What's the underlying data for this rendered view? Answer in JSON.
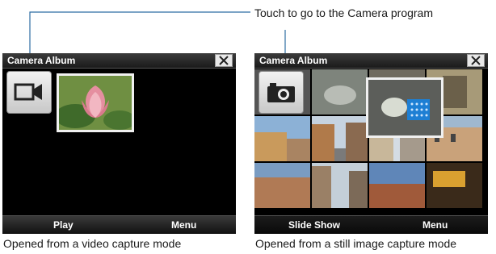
{
  "callout": {
    "text": "Touch to go to the Camera program"
  },
  "left_screen": {
    "title": "Camera Album",
    "mode_button": "video-camera-icon",
    "softkeys": {
      "left": "Play",
      "right": "Menu"
    },
    "caption": "Opened from a video capture mode"
  },
  "right_screen": {
    "title": "Camera Album",
    "mode_button": "camera-icon",
    "softkeys": {
      "left": "Slide Show",
      "right": "Menu"
    },
    "caption": "Opened from a still image capture mode"
  },
  "colors": {
    "callout_line": "#2e6da4",
    "screen_bg": "#000000",
    "selection_border": "#f0f0f0"
  }
}
